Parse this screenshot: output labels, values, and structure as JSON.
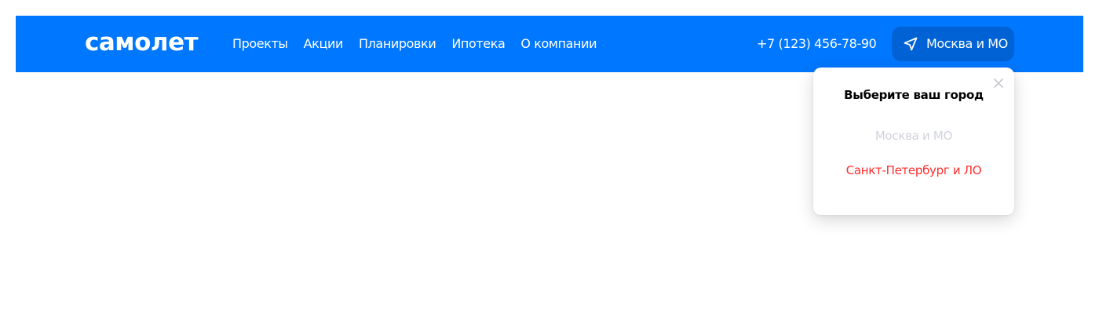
{
  "header": {
    "background_color": "#0077ff",
    "logo_text": "самолет",
    "nav_items": [
      {
        "label": "Проекты"
      },
      {
        "label": "Акции"
      },
      {
        "label": "Планировки"
      },
      {
        "label": "Ипотека"
      },
      {
        "label": "О компании"
      }
    ],
    "phone": "+7 (123) 456-78-90",
    "city_button": {
      "icon": "location-arrow-icon",
      "label": "Москва и МО",
      "background_color": "#0062d4"
    }
  },
  "city_popup": {
    "title": "Выберите ваш город",
    "close_icon": "close-icon",
    "options": [
      {
        "label": "Москва и МО",
        "state": "current",
        "color": "#cfd3da"
      },
      {
        "label": "Санкт-Петербург и ЛО",
        "state": "selectable",
        "color": "#ff2d2d"
      }
    ]
  }
}
